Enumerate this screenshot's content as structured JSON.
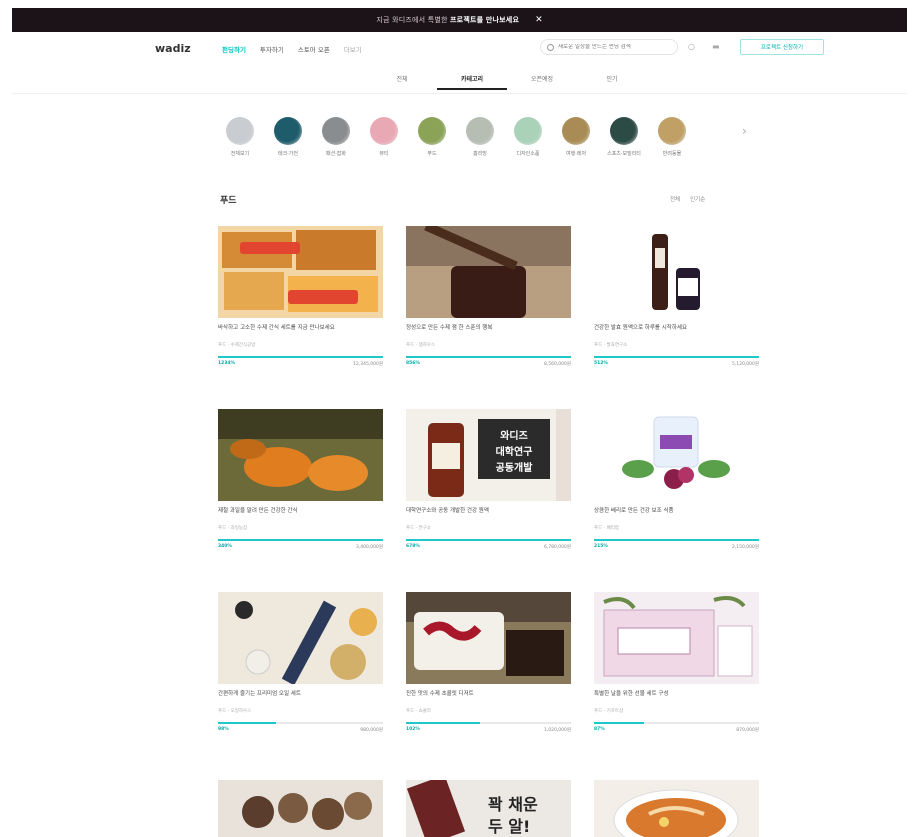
{
  "banner": {
    "text": "지금 와디즈에서 특별한",
    "highlight": "프로젝트를 만나보세요",
    "close": "✕"
  },
  "header": {
    "logo": "wadiz",
    "nav": [
      "펀딩하기",
      "투자하기",
      "스토어 오픈",
      "더보기"
    ],
    "search_placeholder": "새로운 일상을 만드는 펀딩 검색",
    "cta": "프로젝트 신청하기"
  },
  "subtabs": [
    "전체",
    "카테고리",
    "오픈예정",
    "인기"
  ],
  "categories": [
    {
      "label": "전체보기",
      "color": "#c9ccd1"
    },
    {
      "label": "테크·가전",
      "color": "#1f5c6b"
    },
    {
      "label": "패션·잡화",
      "color": "#8a8d8f"
    },
    {
      "label": "뷰티",
      "color": "#e9a9b4"
    },
    {
      "label": "푸드",
      "color": "#8aa357"
    },
    {
      "label": "홈리빙",
      "color": "#b6bdb2"
    },
    {
      "label": "디자인소품",
      "color": "#a9d2b8"
    },
    {
      "label": "여행·레저",
      "color": "#a98c55"
    },
    {
      "label": "스포츠·모빌리티",
      "color": "#2d4b45"
    },
    {
      "label": "반려동물",
      "color": "#c1a066"
    }
  ],
  "section": {
    "title": "푸드",
    "filters": [
      "전체",
      "인기순"
    ]
  },
  "products": [
    {
      "title": "바삭하고 고소한 수제 간식 세트를 지금 만나보세요",
      "maker": "푸드 · 수제간식공방",
      "pct": "1234%",
      "amount": "12,345,000원",
      "fill": 1.0
    },
    {
      "title": "정성으로 만든 수제 잼 한 스푼의 행복",
      "maker": "푸드 · 잼하우스",
      "pct": "856%",
      "amount": "8,560,000원",
      "fill": 1.0
    },
    {
      "title": "건강한 발효 원액으로 하루를 시작하세요",
      "maker": "푸드 · 발효연구소",
      "pct": "512%",
      "amount": "5,120,000원",
      "fill": 1.0
    },
    {
      "title": "제철 과일을 말려 만든 건강한 간식",
      "maker": "푸드 · 과일농장",
      "pct": "340%",
      "amount": "3,400,000원",
      "fill": 1.0
    },
    {
      "title": "대학연구소와 공동 개발한 건강 원액",
      "maker": "푸드 · 연구소",
      "pct": "678%",
      "amount": "6,780,000원",
      "fill": 1.0
    },
    {
      "title": "상큼한 베리로 만든 건강 보조 식품",
      "maker": "푸드 · 베리팜",
      "pct": "215%",
      "amount": "2,150,000원",
      "fill": 1.0
    },
    {
      "title": "간편하게 즐기는 프리미엄 오일 세트",
      "maker": "푸드 · 오일하우스",
      "pct": "98%",
      "amount": "980,000원",
      "fill": 0.35
    },
    {
      "title": "진한 맛의 수제 초콜릿 디저트",
      "maker": "푸드 · 쇼콜라",
      "pct": "102%",
      "amount": "1,020,000원",
      "fill": 0.45
    },
    {
      "title": "특별한 날을 위한 선물 세트 구성",
      "maker": "푸드 · 기프트샵",
      "pct": "87%",
      "amount": "870,000원",
      "fill": 0.3
    }
  ]
}
